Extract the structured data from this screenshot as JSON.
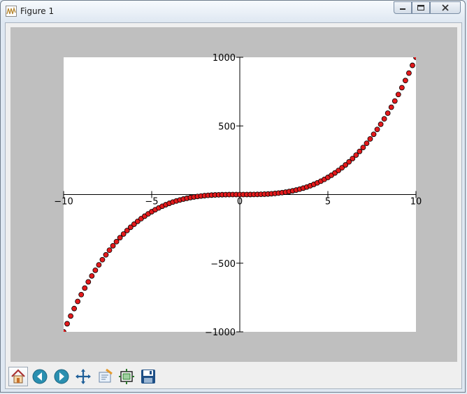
{
  "window": {
    "title": "Figure 1"
  },
  "chart_data": {
    "type": "scatter",
    "function": "y = x^3",
    "x": [
      -10,
      -9.8,
      -9.6,
      -9.4,
      -9.2,
      -9,
      -8.8,
      -8.6,
      -8.4,
      -8.2,
      -8,
      -7.8,
      -7.6,
      -7.4,
      -7.2,
      -7,
      -6.8,
      -6.6,
      -6.4,
      -6.2,
      -6,
      -5.8,
      -5.6,
      -5.4,
      -5.2,
      -5,
      -4.8,
      -4.6,
      -4.4,
      -4.2,
      -4,
      -3.8,
      -3.6,
      -3.4,
      -3.2,
      -3,
      -2.8,
      -2.6,
      -2.4,
      -2.2,
      -2,
      -1.8,
      -1.6,
      -1.4,
      -1.2,
      -1,
      -0.8,
      -0.6,
      -0.4,
      -0.2,
      0,
      0.2,
      0.4,
      0.6,
      0.8,
      1,
      1.2,
      1.4,
      1.6,
      1.8,
      2,
      2.2,
      2.4,
      2.6,
      2.8,
      3,
      3.2,
      3.4,
      3.6,
      3.8,
      4,
      4.2,
      4.4,
      4.6,
      4.8,
      5,
      5.2,
      5.4,
      5.6,
      5.8,
      6,
      6.2,
      6.4,
      6.6,
      6.8,
      7,
      7.2,
      7.4,
      7.6,
      7.8,
      8,
      8.2,
      8.4,
      8.6,
      8.8,
      9,
      9.2,
      9.4,
      9.6,
      9.8,
      10
    ],
    "xlim": [
      -10,
      10
    ],
    "ylim": [
      -1000,
      1000
    ],
    "x_ticks": [
      -10,
      -5,
      0,
      5,
      10
    ],
    "y_ticks": [
      -1000,
      -500,
      500,
      1000
    ],
    "x_tick_labels": [
      "−10",
      "−5",
      "0",
      "5",
      "10"
    ],
    "y_tick_labels": [
      "−1000",
      "−500",
      "500",
      "1000"
    ],
    "marker_color": "#e31a1c",
    "marker_edge": "#000000",
    "spines": "centered",
    "grid": false,
    "title": "",
    "xlabel": "",
    "ylabel": ""
  },
  "toolbar": {
    "tools": [
      {
        "icon": "home-icon"
      },
      {
        "icon": "back-arrow-icon"
      },
      {
        "icon": "forward-arrow-icon"
      },
      {
        "icon": "pan-icon"
      },
      {
        "icon": "zoom-rect-icon"
      },
      {
        "icon": "subplots-icon"
      },
      {
        "icon": "save-icon"
      }
    ]
  },
  "colors": {
    "figure_bg": "#bfbfbf",
    "axes_bg": "#ffffff"
  }
}
